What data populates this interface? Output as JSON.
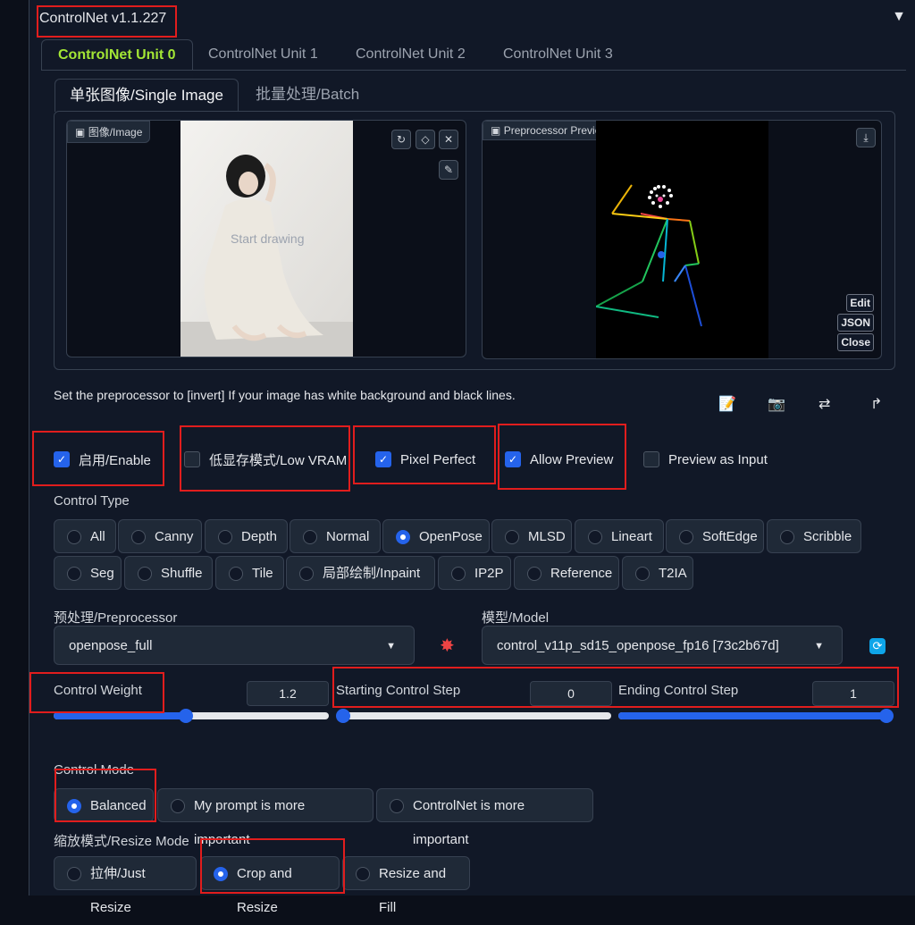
{
  "header": {
    "title": "ControlNet v1.1.227",
    "collapse_glyph": "▼"
  },
  "tabs": [
    "ControlNet Unit 0",
    "ControlNet Unit 1",
    "ControlNet Unit 2",
    "ControlNet Unit 3"
  ],
  "subtabs": [
    "单张图像/Single Image",
    "批量处理/Batch"
  ],
  "image_panel": {
    "label": "图像/Image",
    "overlay_text": "Start drawing"
  },
  "preview_panel": {
    "label": "Preprocessor Preview",
    "buttons": [
      "Edit",
      "JSON",
      "Close"
    ]
  },
  "hint": "Set the preprocessor to [invert] If your image has white background and black lines.",
  "checkboxes": [
    {
      "label": "启用/Enable",
      "checked": true
    },
    {
      "label": "低显存模式/Low VRAM",
      "checked": false
    },
    {
      "label": "Pixel Perfect",
      "checked": true
    },
    {
      "label": "Allow Preview",
      "checked": true
    },
    {
      "label": "Preview as Input",
      "checked": false
    }
  ],
  "control_type": {
    "label": "Control Type",
    "row1": [
      "All",
      "Canny",
      "Depth",
      "Normal",
      "OpenPose",
      "MLSD",
      "Lineart",
      "SoftEdge",
      "Scribble"
    ],
    "row2": [
      "Seg",
      "Shuffle",
      "Tile",
      "局部绘制/Inpaint",
      "IP2P",
      "Reference",
      "T2IA"
    ],
    "selected": "OpenPose"
  },
  "preprocessor": {
    "label": "预处理/Preprocessor",
    "value": "openpose_full"
  },
  "model": {
    "label": "模型/Model",
    "value": "control_v11p_sd15_openpose_fp16 [73c2b67d]"
  },
  "sliders": {
    "weight": {
      "label": "Control Weight",
      "value": "1.2",
      "fraction": 0.48
    },
    "start": {
      "label": "Starting Control Step",
      "value": "0",
      "fraction": 0.0
    },
    "end": {
      "label": "Ending Control Step",
      "value": "1",
      "fraction": 1.0
    }
  },
  "control_mode": {
    "label": "Control Mode",
    "options": [
      "Balanced",
      "My prompt is more important",
      "ControlNet is more important"
    ],
    "selected": "Balanced"
  },
  "resize_mode": {
    "label": "缩放模式/Resize Mode",
    "options": [
      "拉伸/Just Resize",
      "Crop and Resize",
      "Resize and Fill"
    ],
    "selected": "Crop and Resize"
  },
  "colors": {
    "accent": "#2563eb",
    "active_tab": "#a3e635",
    "highlight": "#e11d1d"
  }
}
